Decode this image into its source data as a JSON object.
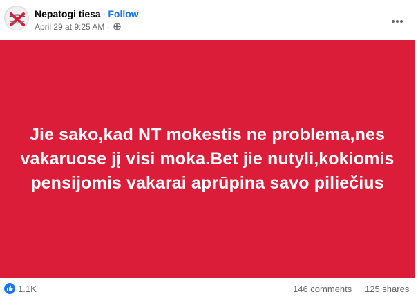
{
  "post": {
    "page_name": "Nepatogi tiesa",
    "separator": "·",
    "follow_label": "Follow",
    "timestamp": "April 29 at 9:25 AM",
    "meta_separator": "·",
    "privacy_icon": "globe-icon",
    "more_icon": "more-options-icon"
  },
  "banner": {
    "background_color": "#dc1d3a",
    "text_color": "#ffffff",
    "text": "Jie sako,kad NT mokestis ne problema,nes vakaruose jį visi moka.Bet jie nutyli,kokiomis pensijomis vakarai aprūpina savo piliečius"
  },
  "footer": {
    "reaction_icon": "like-icon",
    "reaction_count": "1.1K",
    "comments": "146 comments",
    "shares": "125 shares"
  },
  "colors": {
    "accent": "#1877f2",
    "muted_text": "#65676b"
  }
}
